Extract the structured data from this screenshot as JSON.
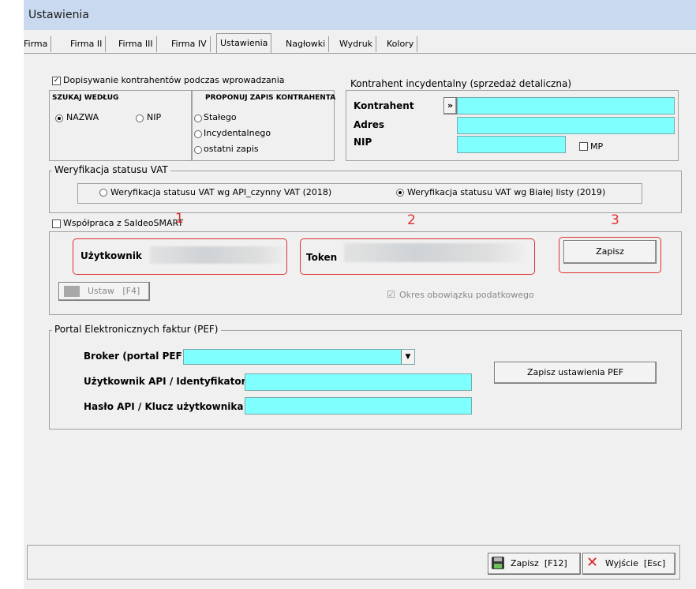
{
  "window": {
    "title": "Ustawienia"
  },
  "tabs": [
    "Firma",
    "Firma II",
    "Firma III",
    "Firma IV",
    "Ustawienia",
    "Nagłowki",
    "Wydruk",
    "Kolory"
  ],
  "active_tab": "Ustawienia",
  "contractor": {
    "append_label": "Dopisywanie kontrahentów podczas wprowadzania",
    "append_checked": true,
    "search_title": "SZUKAJ WEDŁUG",
    "search_name": "NAZWA",
    "search_nip": "NIP",
    "search_selected": "NAZWA",
    "propose_title": "PROPONUJ ZAPIS KONTRAHENTA",
    "propose_options": [
      "Stałego",
      "Incydentalnego",
      "ostatni zapis"
    ]
  },
  "incidental": {
    "title": "Kontrahent incydentalny (sprzedaż detaliczna)",
    "contractor_label": "Kontrahent",
    "arrow": "»",
    "address_label": "Adres",
    "nip_label": "NIP",
    "mp_label": "MP",
    "mp_checked": false
  },
  "vat": {
    "title": "Weryfikacja statusu VAT",
    "option_api": "Weryfikacja statusu VAT wg API_czynny VAT (2018)",
    "option_whitelist": "Weryfikacja statusu VAT wg Białej listy (2019)",
    "selected": "whitelist"
  },
  "saldeo": {
    "label": "Współpraca z SaldeoSMART",
    "checked": false,
    "user_label": "Użytkownik",
    "token_label": "Token",
    "save_button": "Zapisz",
    "set_button": "Ustaw   [F4]",
    "tax_period_label": "Okres obowiązku podatkowego",
    "tax_period_checked": true
  },
  "annotations": [
    "1",
    "2",
    "3"
  ],
  "pef": {
    "title": "Portal Elektronicznych faktur (PEF)",
    "broker_label": "Broker (portal PEF)",
    "api_user_label": "Użytkownik API / Identyfikator",
    "api_key_label": "Hasło API / Klucz użytkownika",
    "save_button": "Zapisz ustawienia PEF"
  },
  "footer": {
    "save_button": "Zapisz  [F12]",
    "exit_button": "Wyjście  [Esc]"
  },
  "colors": {
    "field": "#80ffff",
    "annotation": "#e03030",
    "titlebar": "#c9daf0"
  }
}
